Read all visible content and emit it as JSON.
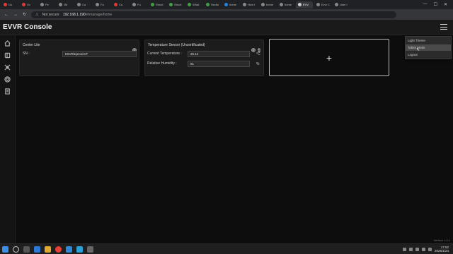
{
  "browser": {
    "tabs": [
      {
        "label": "Du",
        "color": "#e53935"
      },
      {
        "label": "Vo",
        "color": "#e53935"
      },
      {
        "label": "Pe",
        "color": "#888888"
      },
      {
        "label": "JM",
        "color": "#888888"
      },
      {
        "label": "Ca",
        "color": "#888888"
      },
      {
        "label": "Fa",
        "color": "#888888"
      },
      {
        "label": "Ca",
        "color": "#e53935"
      },
      {
        "label": "Fu",
        "color": "#888888"
      },
      {
        "label": "Struct",
        "color": "#43a047"
      },
      {
        "label": "Struct",
        "color": "#43a047"
      },
      {
        "label": "What",
        "color": "#43a047"
      },
      {
        "label": "Sectio",
        "color": "#43a047"
      },
      {
        "label": "home",
        "color": "#1e88e5"
      },
      {
        "label": "How t",
        "color": "#888888"
      },
      {
        "label": "home",
        "color": "#888888"
      },
      {
        "label": "home",
        "color": "#888888"
      },
      {
        "label": "EVV",
        "color": "#cccccc",
        "active": true
      },
      {
        "label": "Evvr C",
        "color": "#888888"
      },
      {
        "label": "User I",
        "color": "#888888"
      }
    ],
    "security_label": "Not secure",
    "url_host": "192.168.1.190",
    "url_path": "/#/manage/home"
  },
  "app": {
    "title": "EVVR Console",
    "version": "Version 1.3.1"
  },
  "sidebar": {
    "items": [
      {
        "name": "home-icon",
        "active": true
      },
      {
        "name": "devices-icon"
      },
      {
        "name": "automation-icon"
      },
      {
        "name": "settings-icon"
      },
      {
        "name": "logs-icon"
      }
    ]
  },
  "cards": {
    "center_lite": {
      "title": "Center Lite",
      "sn_label": "SN :",
      "sn_value": "E6VRbqeoxcCF"
    },
    "temperature_sensor": {
      "title": "Temperature Sensor (Uncertificated)",
      "current_temp_label": "Current Temperature :",
      "current_temp_value": "25.14",
      "temp_unit": "°C",
      "humidity_label": "Relative Humidity :",
      "humidity_value": "81",
      "humidity_unit": "%"
    },
    "add_card": {
      "icon": "plus-icon",
      "symbol": "+"
    }
  },
  "menu": {
    "items": [
      {
        "label": "Light Theme"
      },
      {
        "label": "Tablet Mode",
        "hover": true
      },
      {
        "label": "Logout"
      }
    ]
  },
  "taskbar": {
    "time": "17:52",
    "date": "2025/1/24"
  }
}
